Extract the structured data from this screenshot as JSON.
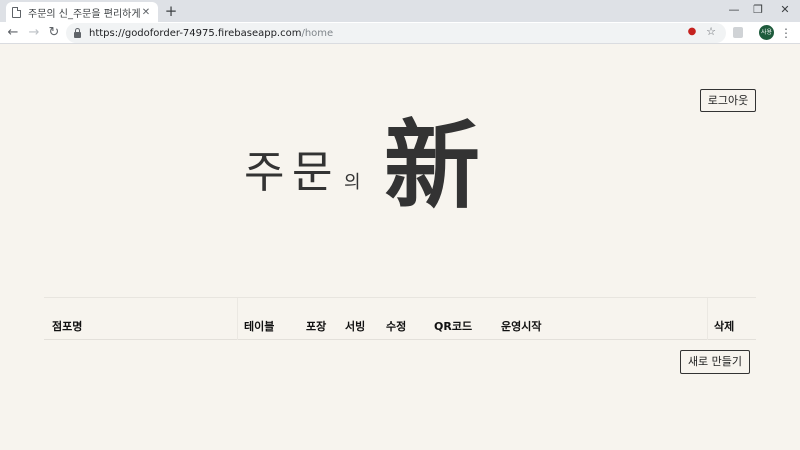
{
  "browser": {
    "tab_title": "주문의 신_주문을 편리하게",
    "tab_close": "✕",
    "new_tab": "+",
    "window_controls": {
      "minimize": "—",
      "restore": "❐",
      "close": "✕"
    },
    "nav": {
      "back": "←",
      "forward": "→",
      "reload": "↻"
    },
    "url": {
      "base": "https://godoforder-74975.firebaseapp.com",
      "path": "/home"
    },
    "star": "☆",
    "profile_initials": "사용",
    "menu": "⋮"
  },
  "header": {
    "logout_label": "로그아웃"
  },
  "logo": {
    "char1": "주",
    "char2": "문",
    "particle": "의",
    "hanja": "新"
  },
  "table": {
    "columns": [
      "점포명",
      "테이블",
      "포장",
      "서빙",
      "수정",
      "QR코드",
      "운영시작",
      "삭제"
    ]
  },
  "actions": {
    "new_label": "새로 만들기"
  },
  "colors": {
    "background": "#f7f4ee",
    "text": "#222222",
    "button_border": "#333333",
    "profile_avatar": "#1e5b3c"
  }
}
